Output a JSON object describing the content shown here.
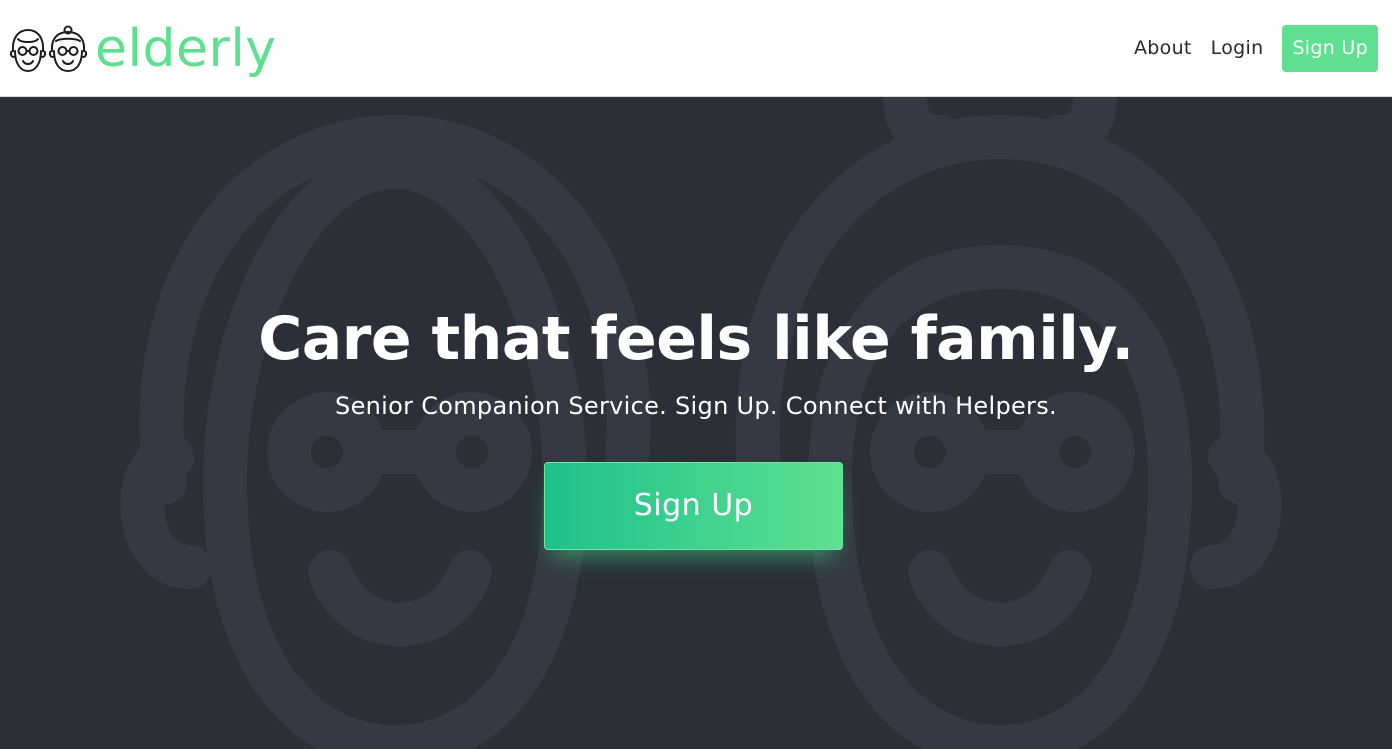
{
  "header": {
    "brand_name": "elderly",
    "brand_logo_icon": "elderly-couple-faces-icon",
    "nav": {
      "about_label": "About",
      "login_label": "Login",
      "signup_label": "Sign Up"
    }
  },
  "hero": {
    "background_icon": "elderly-couple-faces-outline",
    "headline": "Care that feels like family.",
    "subheadline": "Senior Companion Service. Sign Up. Connect with Helpers.",
    "cta_label": "Sign Up"
  },
  "colors": {
    "brand_green": "#5fe091",
    "gradient_start": "#1dc18b",
    "hero_background": "#2b2f37",
    "hero_outline": "#343944",
    "header_background": "#ffffff"
  }
}
